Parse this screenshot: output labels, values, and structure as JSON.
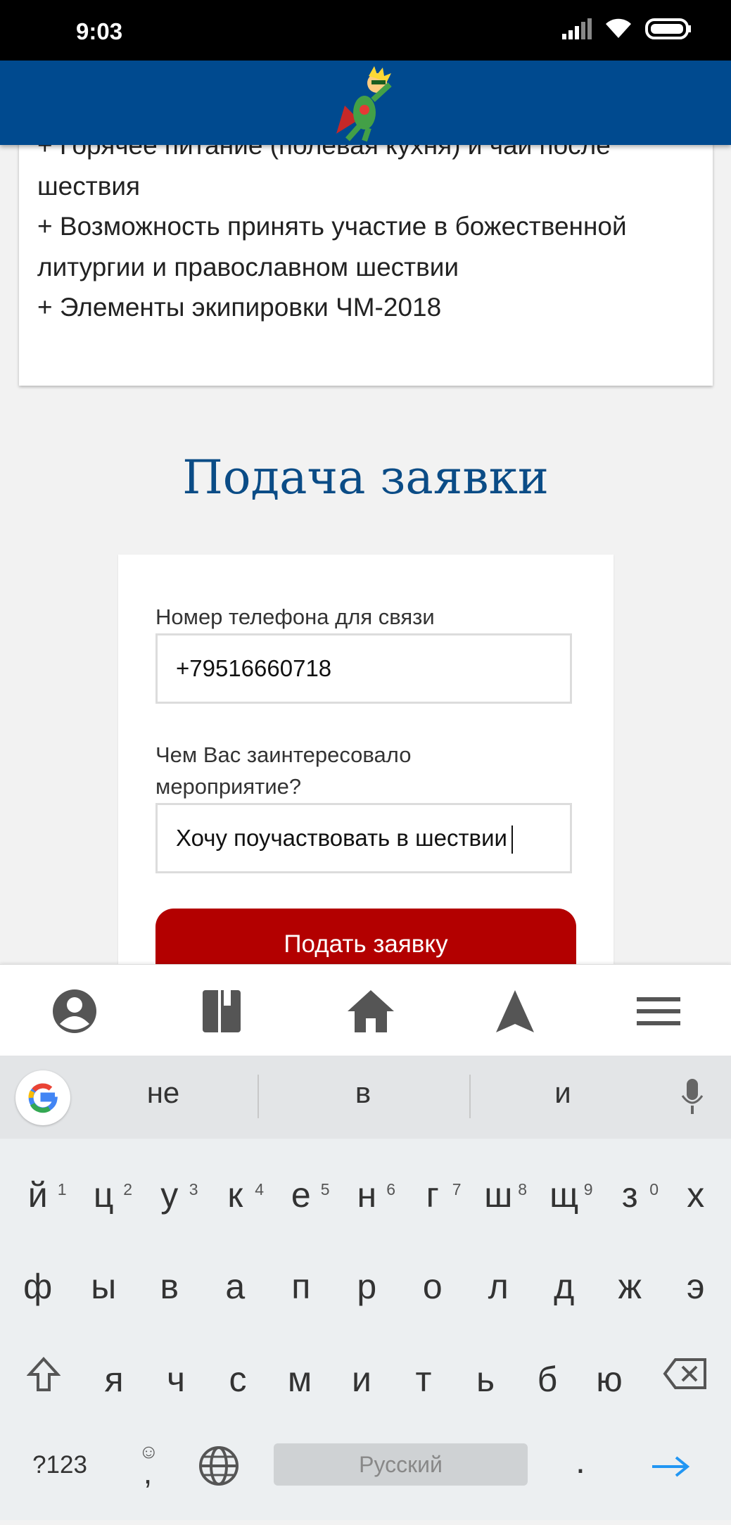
{
  "status": {
    "time": "9:03"
  },
  "card": {
    "lines": [
      "+ Горячее питание (полевая кухня) и чай после",
      "шествия",
      "+ Возможность принять участие в божественной",
      "литургии и православном шествии",
      "+ Элементы экипировки ЧМ-2018"
    ]
  },
  "form": {
    "title": "Подача заявки",
    "phone_label": "Номер телефона для связи",
    "phone_value": "+79516660718",
    "interest_label_1": "Чем Вас заинтересовало",
    "interest_label_2": "мероприятие?",
    "interest_value": "Хочу поучаствовать в шествии",
    "submit_label": "Подать заявку"
  },
  "nav": {
    "items": [
      "profile-icon",
      "book-icon",
      "home-icon",
      "navigation-icon",
      "menu-icon"
    ]
  },
  "keyboard": {
    "suggestions": [
      "не",
      "в",
      "и"
    ],
    "row1": [
      "й",
      "ц",
      "у",
      "к",
      "е",
      "н",
      "г",
      "ш",
      "щ",
      "з",
      "х"
    ],
    "row1_hints": [
      "1",
      "2",
      "3",
      "4",
      "5",
      "6",
      "7",
      "8",
      "9",
      "0"
    ],
    "row2": [
      "ф",
      "ы",
      "в",
      "а",
      "п",
      "р",
      "о",
      "л",
      "д",
      "ж",
      "э"
    ],
    "row3": [
      "я",
      "ч",
      "с",
      "м",
      "и",
      "т",
      "ь",
      "б",
      "ю"
    ],
    "symbols_label": "?123",
    "comma": ",",
    "period": ".",
    "space_label": "Русский"
  },
  "colors": {
    "header": "#004a8f",
    "title": "#0b4c86",
    "submit": "#b30000",
    "enter_arrow": "#2196f3"
  }
}
